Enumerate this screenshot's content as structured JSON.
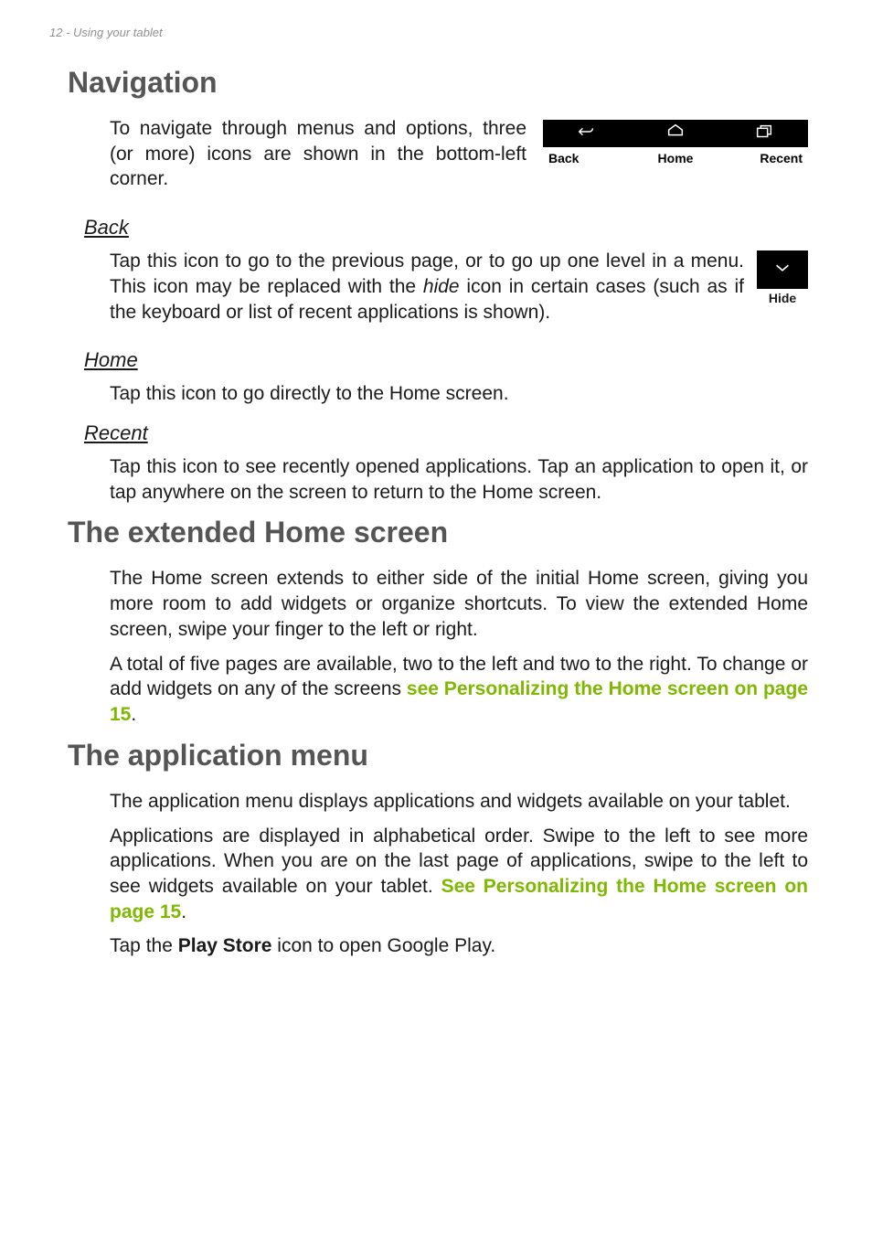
{
  "header": {
    "text": "12 - Using your tablet"
  },
  "navigation": {
    "title": "Navigation",
    "intro": "To navigate through menus and options, three (or more) icons are shown in the bottom-left corner.",
    "nav_labels": {
      "back": "Back",
      "home": "Home",
      "recent": "Recent"
    },
    "back": {
      "heading": "Back",
      "para_before_italic": "Tap this icon to go to the previous page, or to go up one level in a menu. This icon may be replaced with the ",
      "italic_word": "hide",
      "para_after_italic": " icon in certain cases (such as if the keyboard or list of recent applications is shown).",
      "hide_caption": "Hide"
    },
    "home": {
      "heading": "Home",
      "para": "Tap this icon to go directly to the Home screen."
    },
    "recent": {
      "heading": "Recent",
      "para": "Tap this icon to see recently opened applications. Tap an application to open it, or tap anywhere on the screen to return to the Home screen."
    }
  },
  "extended": {
    "title": "The extended Home screen",
    "para1": "The Home screen extends to either side of the initial Home screen, giving you more room to add widgets or organize shortcuts. To view the extended Home screen, swipe your finger to the left or right.",
    "para2_before_link": "A total of five pages are available, two to the left and two to the right. To change or add widgets on any of the screens ",
    "para2_link": "see Personalizing the Home screen on page 15",
    "para2_after_link": "."
  },
  "appmenu": {
    "title": "The application menu",
    "para1": "The application menu displays applications and widgets available on your tablet.",
    "para2_before_link": "Applications are displayed in alphabetical order. Swipe to the left to see more applications. When you are on the last page of applications, swipe to the left to see widgets available on your tablet. ",
    "para2_link": "See Personalizing the Home screen on page 15",
    "para2_after_link": ".",
    "para3_before_bold": "Tap the ",
    "para3_bold": "Play Store",
    "para3_after_bold": " icon to open Google Play."
  }
}
